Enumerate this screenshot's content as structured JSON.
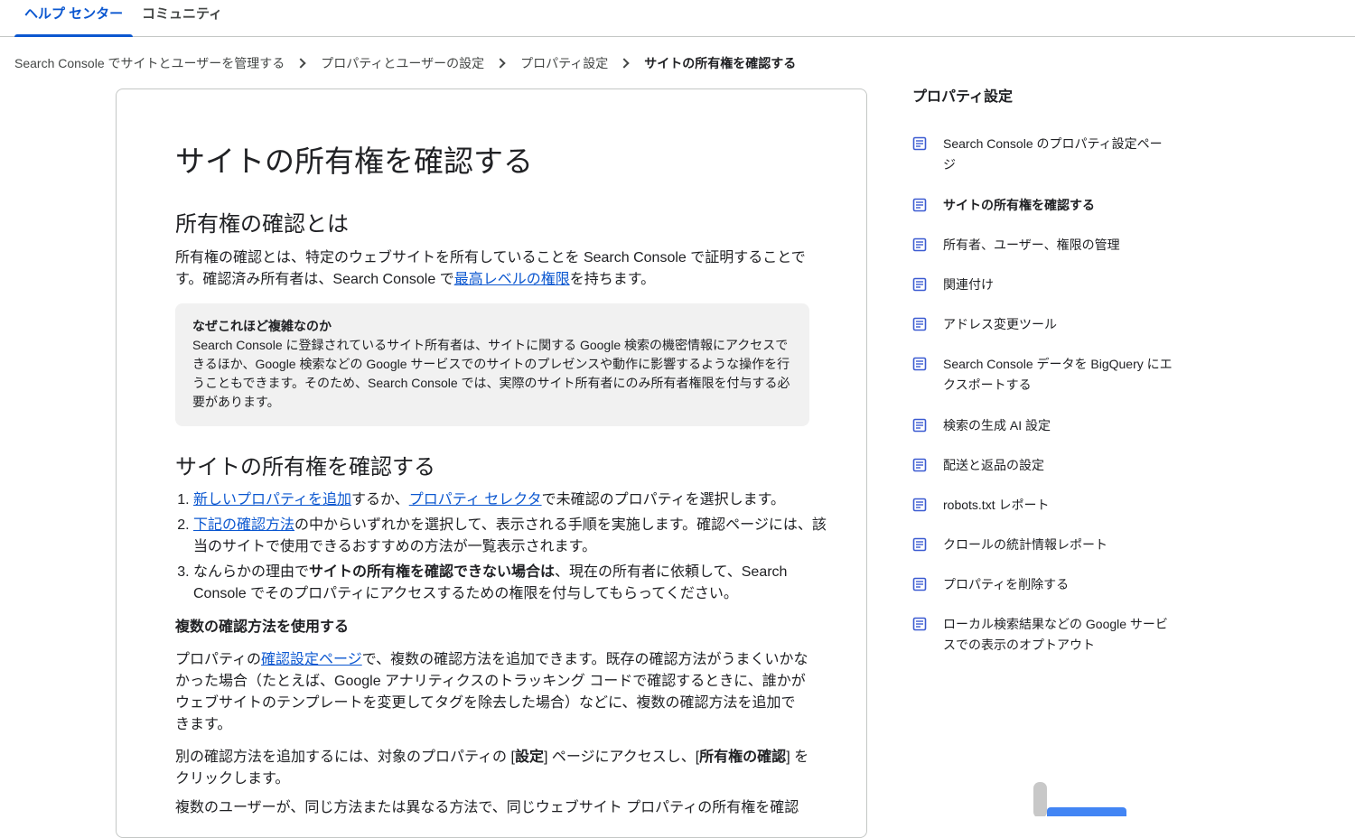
{
  "top_tabs": [
    {
      "label": "ヘルプ センター",
      "active": true
    },
    {
      "label": "コミュニティ",
      "active": false
    }
  ],
  "breadcrumb": [
    "Search Console でサイトとユーザーを管理する",
    "プロパティとユーザーの設定",
    "プロパティ設定",
    "サイトの所有権を確認する"
  ],
  "article": {
    "title": "サイトの所有権を確認する",
    "section1": {
      "heading": "所有権の確認とは",
      "p_before": "所有権の確認とは、特定のウェブサイトを所有していることを Search Console で証明することです。確認済み所有者は、Search Console で",
      "p_link": "最高レベルの権限",
      "p_after": "を持ちます。"
    },
    "callout": {
      "title": "なぜこれほど複雑なのか",
      "text": "Search Console に登録されているサイト所有者は、サイトに関する Google 検索の機密情報にアクセスできるほか、Google 検索などの Google サービスでのサイトのプレゼンスや動作に影響するような操作を行うこともできます。そのため、Search Console では、実際のサイト所有者にのみ所有者権限を付与する必要があります。"
    },
    "section2": {
      "heading": "サイトの所有権を確認する",
      "step1": {
        "link1": "新しいプロパティを追加",
        "mid": "するか、",
        "link2": "プロパティ セレクタ",
        "end": "で未確認のプロパティを選択します。"
      },
      "step2": {
        "link": "下記の確認方法",
        "end": "の中からいずれかを選択して、表示される手順を実施します。確認ページには、該当のサイトで使用できるおすすめの方法が一覧表示されます。"
      },
      "step3": {
        "start": "なんらかの理由で",
        "bold": "サイトの所有権を確認できない場合は",
        "end": "、現在の所有者に依頼して、Search Console でそのプロパティにアクセスするための権限を付与してもらってください。"
      }
    },
    "section3": {
      "heading": "複数の確認方法を使用する",
      "p1_before": "プロパティの",
      "p1_link": "確認設定ページ",
      "p1_after": "で、複数の確認方法を追加できます。既存の確認方法がうまくいかなかった場合（たとえば、Google アナリティクスのトラッキング コードで確認するときに、誰かがウェブサイトのテンプレートを変更してタグを除去した場合）などに、複数の確認方法を追加できます。",
      "p2_a": "別の確認方法を追加するには、対象のプロパティの [",
      "p2_b1": "設定",
      "p2_c": "] ページにアクセスし、[",
      "p2_b2": "所有権の確認",
      "p2_d": "] をクリックします。",
      "p3": "複数のユーザーが、同じ方法または異なる方法で、同じウェブサイト プロパティの所有権を確認"
    }
  },
  "sidebar": {
    "title": "プロパティ設定",
    "items": [
      {
        "label": "Search Console のプロパティ設定ページ",
        "active": false
      },
      {
        "label": "サイトの所有権を確認する",
        "active": true
      },
      {
        "label": "所有者、ユーザー、権限の管理",
        "active": false
      },
      {
        "label": "関連付け",
        "active": false
      },
      {
        "label": "アドレス変更ツール",
        "active": false
      },
      {
        "label": "Search Console データを BigQuery にエクスポートする",
        "active": false
      },
      {
        "label": "検索の生成 AI 設定",
        "active": false
      },
      {
        "label": "配送と返品の設定",
        "active": false
      },
      {
        "label": "robots.txt レポート",
        "active": false
      },
      {
        "label": "クロールの統計情報レポート",
        "active": false
      },
      {
        "label": "プロパティを削除する",
        "active": false
      },
      {
        "label": "ローカル検索結果などの Google サービスでの表示のオプトアウト",
        "active": false
      }
    ],
    "icon": "document-icon"
  },
  "colors": {
    "accent": "#0b57d0",
    "text": "#202124",
    "muted": "#444746",
    "callout_bg": "#f1f1f1",
    "icon": "#3c5bd1"
  }
}
